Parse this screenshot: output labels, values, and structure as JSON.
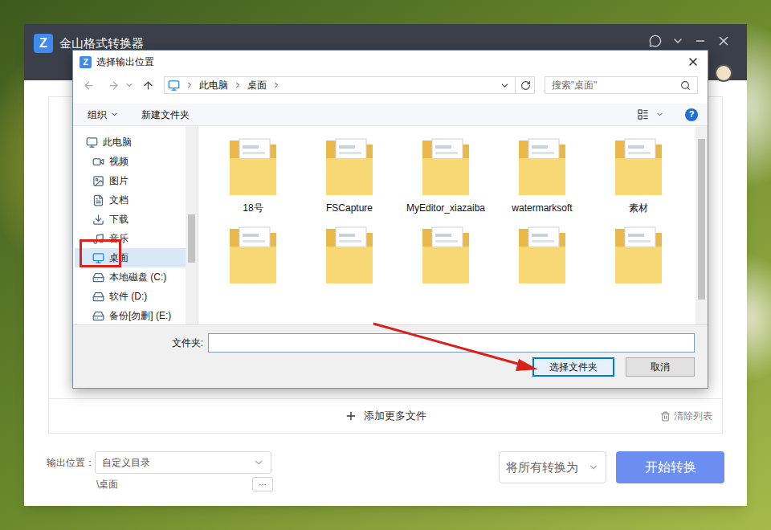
{
  "app": {
    "title": "金山格式转换器",
    "logo": "Z",
    "add_more": "添加更多文件",
    "clear": "清除列表",
    "output_label": "输出位置：",
    "output_mode": "自定义目录",
    "output_path": "\\桌面",
    "more_button": "···",
    "convert_all": "将所有转换为",
    "start": "开始转换"
  },
  "dialog": {
    "title": "选择输出位置",
    "logo": "Z",
    "breadcrumb": [
      "此电脑",
      "桌面"
    ],
    "search_placeholder": "搜索\"桌面\"",
    "toolbar": [
      "组织",
      "新建文件夹"
    ],
    "help": "?",
    "nav": [
      {
        "label": "此电脑",
        "kind": "computer",
        "selected": false,
        "highlighted": false
      },
      {
        "label": "视频",
        "kind": "video",
        "selected": false,
        "highlighted": false
      },
      {
        "label": "图片",
        "kind": "image",
        "selected": false,
        "highlighted": false
      },
      {
        "label": "文档",
        "kind": "document",
        "selected": false,
        "highlighted": false
      },
      {
        "label": "下载",
        "kind": "download",
        "selected": false,
        "highlighted": false
      },
      {
        "label": "音乐",
        "kind": "music",
        "selected": false,
        "highlighted": false
      },
      {
        "label": "桌面",
        "kind": "desktop",
        "selected": true,
        "highlighted": true
      },
      {
        "label": "本地磁盘 (C:)",
        "kind": "disk",
        "selected": false,
        "highlighted": false
      },
      {
        "label": "软件 (D:)",
        "kind": "disk",
        "selected": false,
        "highlighted": false
      },
      {
        "label": "备份[勿删] (E:)",
        "kind": "disk",
        "selected": false,
        "highlighted": false
      }
    ],
    "folders": [
      {
        "name": "18号"
      },
      {
        "name": "FSCapture"
      },
      {
        "name": "MyEditor_xiazaiba"
      },
      {
        "name": "watermarksoft"
      },
      {
        "name": "素材"
      },
      {
        "name": ""
      },
      {
        "name": ""
      },
      {
        "name": ""
      },
      {
        "name": ""
      },
      {
        "name": ""
      }
    ],
    "folder_label": "文件夹:",
    "folder_value": "",
    "buttons": [
      {
        "label": "选择文件夹",
        "default": true
      },
      {
        "label": "取消",
        "default": false
      }
    ]
  },
  "annotations": {
    "arrow": true
  }
}
